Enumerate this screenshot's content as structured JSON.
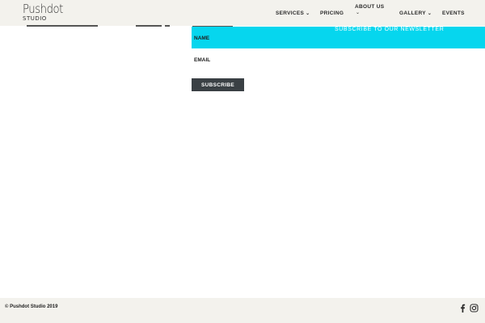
{
  "brand": {
    "logo_main": "Pushdot",
    "logo_sub": "STUDIO"
  },
  "nav": {
    "services": "SERVICES",
    "pricing": "PRICING",
    "about": "ABOUT US",
    "gallery": "GALLERY",
    "events": "EVENTS"
  },
  "newsletter": {
    "title": "SUBSCRIBE TO OUR NEWSLETTER",
    "name_label": "NAME",
    "email_label": "EMAIL",
    "name_value": "",
    "email_value": "",
    "subscribe_label": "SUBSCRIBE",
    "banner_color": "#06d6ee",
    "button_color": "#3a4044"
  },
  "footer": {
    "copyright": "© Pushdot Studio 2019",
    "social_icons": [
      "facebook-icon",
      "instagram-icon"
    ]
  }
}
